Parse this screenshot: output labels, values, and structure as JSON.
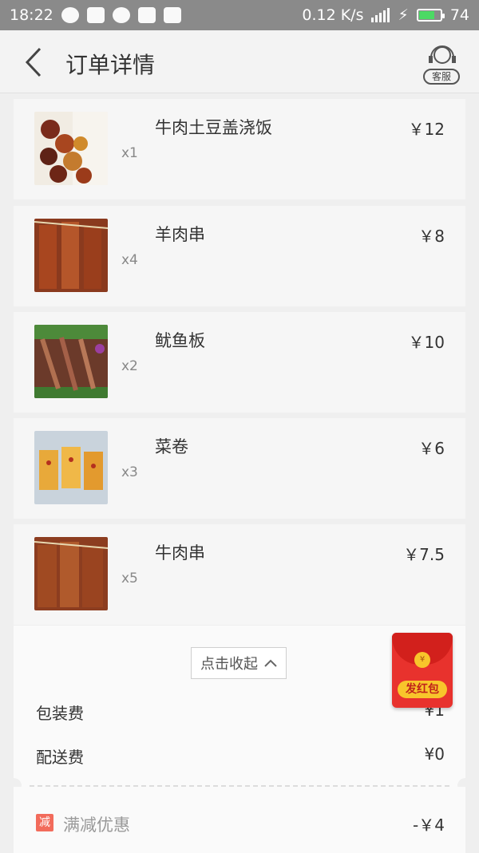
{
  "status_bar": {
    "time": "18:22",
    "speed": "0.12 K/s",
    "battery": "74"
  },
  "header": {
    "title": "订单详情",
    "customer_service": "客服"
  },
  "items": [
    {
      "name": "牛肉土豆盖浇饭",
      "qty": "x1",
      "price": "￥12"
    },
    {
      "name": "羊肉串",
      "qty": "x4",
      "price": "￥8"
    },
    {
      "name": "鱿鱼板",
      "qty": "x2",
      "price": "￥10"
    },
    {
      "name": "菜卷",
      "qty": "x3",
      "price": "￥6"
    },
    {
      "name": "牛肉串",
      "qty": "x5",
      "price": "￥7.5"
    }
  ],
  "collapse_label": "点击收起",
  "fees": [
    {
      "label": "包装费",
      "value": "¥1"
    },
    {
      "label": "配送费",
      "value": "¥0"
    }
  ],
  "discount": {
    "badge": "减",
    "label": "满减优惠",
    "value": "-￥4"
  },
  "hongbao": {
    "label": "发红包"
  },
  "colors": {
    "accent_red": "#e8322d",
    "gold": "#f8c52b"
  }
}
